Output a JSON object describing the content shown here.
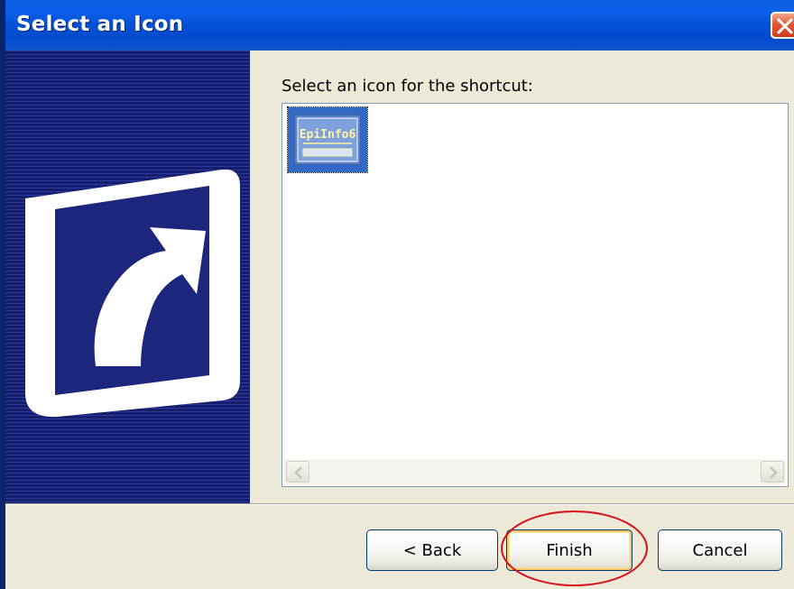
{
  "window": {
    "title": "Select an Icon",
    "close_icon": "close-icon"
  },
  "banner": {
    "icon": "shortcut-arrow-icon"
  },
  "main": {
    "prompt": "Select an icon for the shortcut:",
    "icons": [
      {
        "name": "EpiInfo6",
        "selected": true
      }
    ]
  },
  "buttons": {
    "back": "< Back",
    "finish": "Finish",
    "cancel": "Cancel"
  },
  "annotation": {
    "highlight_color": "#d6101a",
    "highlights": "finish-button"
  },
  "colors": {
    "titlebar": "#0553d8",
    "banner": "#1f2a82",
    "dialog_bg": "#ece9d8",
    "selection": "#316ac5"
  }
}
